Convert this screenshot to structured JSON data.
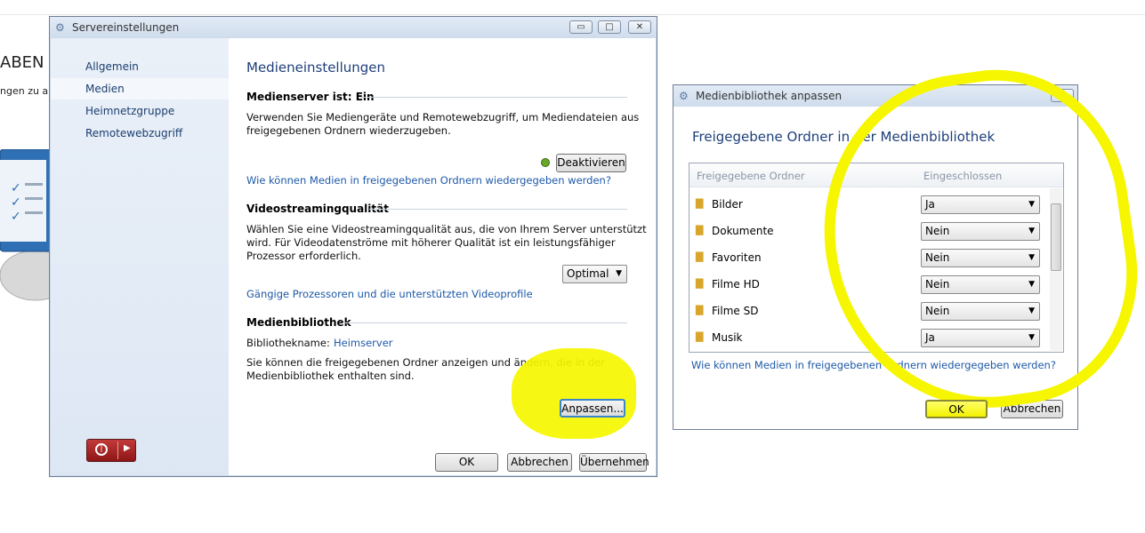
{
  "background": {
    "heading_fragment": "ABEN U",
    "text_fragment": "ngen zu all"
  },
  "server_window": {
    "title": "Servereinstellungen",
    "title_buttons": {
      "minimize": "▭",
      "maximize": "□",
      "close": "✕"
    },
    "nav": {
      "items": [
        {
          "label": "Allgemein"
        },
        {
          "label": "Medien"
        },
        {
          "label": "Heimnetzgruppe"
        },
        {
          "label": "Remotewebzugriff"
        }
      ],
      "selected": "Medien"
    },
    "content": {
      "title": "Medieneinstellungen",
      "media_server": {
        "heading": "Medienserver ist: Ein",
        "text1": "Verwenden Sie Mediengeräte und Remotewebzugriff, um Mediendateien aus",
        "text2": "freigegebenen Ordnern wiederzugeben.",
        "button": "Deaktivieren",
        "link": "Wie können Medien in freigegebenen Ordnern wiedergegeben werden?"
      },
      "streaming": {
        "heading": "Videostreamingqualität",
        "text1": "Wählen Sie eine Videostreamingqualität aus, die von Ihrem Server unterstützt",
        "text2": "wird. Für Videodatenströme mit höherer Qualität ist ein leistungsfähiger",
        "text3": "Prozessor erforderlich.",
        "dropdown": "Optimal",
        "link": "Gängige Prozessoren und die unterstützten Videoprofile"
      },
      "library": {
        "heading": "Medienbibliothek",
        "name_label": "Bibliothekname:",
        "name_value": "Heimserver",
        "text1": "Sie können die freigegebenen Ordner anzeigen und ändern, die in der",
        "text2": "Medienbibliothek enthalten sind.",
        "button": "Anpassen..."
      }
    },
    "footer": {
      "ok": "OK",
      "cancel": "Abbrechen",
      "apply": "Übernehmen"
    }
  },
  "library_window": {
    "title": "Medienbibliothek anpassen",
    "close": "✕",
    "heading": "Freigegebene Ordner in der Medienbibliothek",
    "columns": {
      "folder": "Freigegebene Ordner",
      "included": "Eingeschlossen"
    },
    "rows": [
      {
        "name": "Bilder",
        "value": "Ja"
      },
      {
        "name": "Dokumente",
        "value": "Nein"
      },
      {
        "name": "Favoriten",
        "value": "Nein"
      },
      {
        "name": "Filme HD",
        "value": "Nein"
      },
      {
        "name": "Filme SD",
        "value": "Nein"
      },
      {
        "name": "Musik",
        "value": "Ja"
      }
    ],
    "link": "Wie können Medien in freigegebenen Ordnern wiedergegeben werden?",
    "ok": "OK",
    "cancel": "Abbrechen"
  },
  "colors": {
    "highlight": "#f6f600",
    "link": "#1e59a8",
    "heading": "#1e3f7a"
  }
}
